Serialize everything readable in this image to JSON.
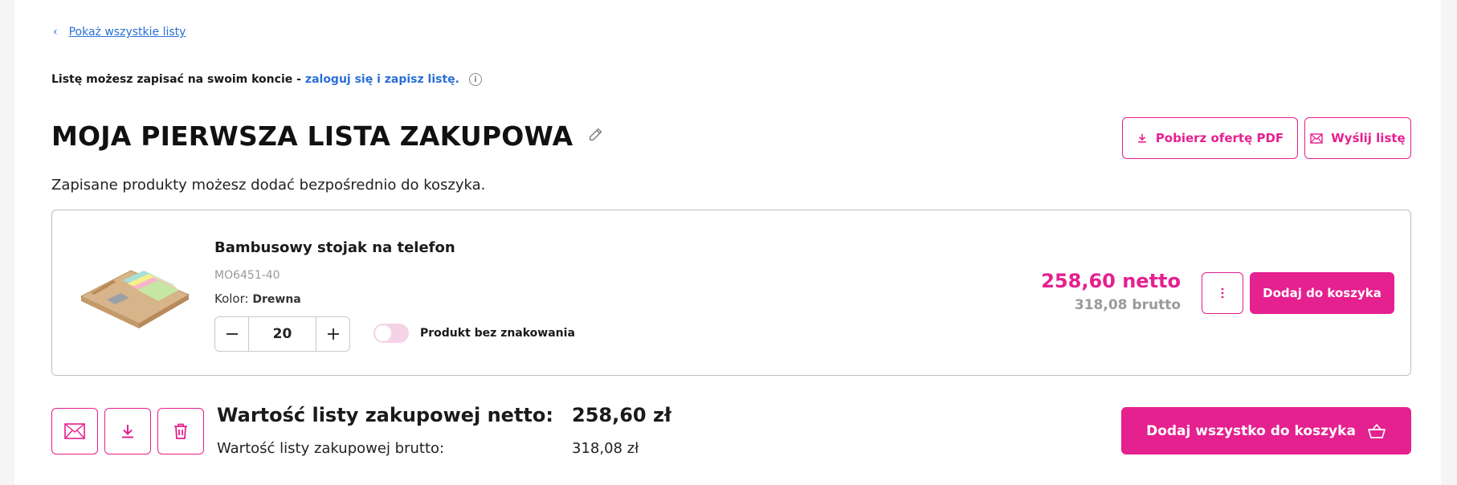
{
  "nav": {
    "back_label": "Pokaż wszystkie listy"
  },
  "login_note": {
    "text": "Listę możesz zapisać na swoim koncie - ",
    "link": "zaloguj się i zapisz listę."
  },
  "header": {
    "title": "MOJA PIERWSZA LISTA ZAKUPOWA",
    "subtitle": "Zapisane produkty możesz dodać bezpośrednio do koszyka.",
    "pdf_button": "Pobierz ofertę PDF",
    "send_button": "Wyślij listę"
  },
  "product": {
    "name": "Bambusowy stojak na telefon",
    "sku": "MO6451-40",
    "color_label": "Kolor:",
    "color_value": "Drewna",
    "quantity": "20",
    "no_marking_label": "Produkt bez znakowania",
    "no_marking_enabled": false,
    "price_net": "258,60 netto",
    "price_gross": "318,08 brutto",
    "add_to_cart": "Dodaj do koszyka"
  },
  "summary": {
    "net_label": "Wartość listy zakupowej netto:",
    "net_value": "258,60 zł",
    "gross_label": "Wartość listy zakupowej brutto:",
    "gross_value": "318,08 zł",
    "add_all_button": "Dodaj wszystko do koszyka"
  },
  "colors": {
    "accent": "#e5208f",
    "link": "#2a6fd6",
    "toggle_off": "#f4d3e6"
  }
}
